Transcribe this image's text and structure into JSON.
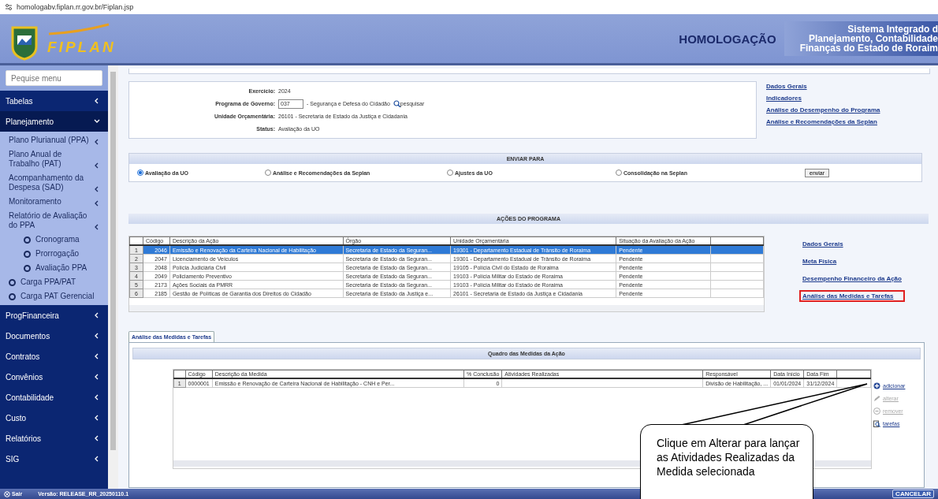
{
  "browser": {
    "url": "homologabv.fiplan.rr.gov.br/Fiplan.jsp"
  },
  "header": {
    "logo_text": "FIPLAN",
    "environment": "HOMOLOGAÇÃO",
    "system_name": [
      "Sistema Integrado d",
      "Planejamento, Contabilidade",
      "Finanças do Estado de Roraim"
    ]
  },
  "sidebar": {
    "search": {
      "placeholder": "Pequise menu"
    },
    "items": [
      {
        "label": "Tabelas",
        "kind": "menu",
        "expanded": false
      },
      {
        "label": "Planejamento",
        "kind": "menu",
        "expanded": true,
        "children": [
          {
            "label": "Plano Plurianual (PPA)",
            "kind": "menu"
          },
          {
            "label": "Plano Anual de Trabalho (PAT)",
            "kind": "menu"
          },
          {
            "label": "Acompanhamento da Despesa (SAD)",
            "kind": "menu"
          },
          {
            "label": "Monitoramento",
            "kind": "menu"
          },
          {
            "label": "Relatório de Avaliação do PPA",
            "kind": "menu",
            "children": [
              {
                "label": "Cronograma",
                "kind": "link"
              },
              {
                "label": "Prorrogação",
                "kind": "link"
              },
              {
                "label": "Avaliação PPA",
                "kind": "link"
              }
            ]
          },
          {
            "label": "Carga PPA/PAT",
            "kind": "link"
          },
          {
            "label": "Carga PAT Gerencial",
            "kind": "link"
          }
        ]
      },
      {
        "label": "ProgFinanceira",
        "kind": "menu",
        "expanded": false
      },
      {
        "label": "Documentos",
        "kind": "menu",
        "expanded": false
      },
      {
        "label": "Contratos",
        "kind": "menu",
        "expanded": false
      },
      {
        "label": "Convênios",
        "kind": "menu",
        "expanded": false
      },
      {
        "label": "Contabilidade",
        "kind": "menu",
        "expanded": false
      },
      {
        "label": "Custo",
        "kind": "menu",
        "expanded": false
      },
      {
        "label": "Relatórios",
        "kind": "menu",
        "expanded": false
      },
      {
        "label": "SIG",
        "kind": "menu",
        "expanded": false
      }
    ]
  },
  "program": {
    "fields": [
      {
        "label": "Exercício:",
        "kind": "text",
        "value": "2024"
      },
      {
        "label": "Programa de Governo:",
        "kind": "input",
        "value": "037",
        "description": "- Segurança e Defesa do Cidadão",
        "action": "pesquisar"
      },
      {
        "label": "Unidade Orçamentária:",
        "kind": "text",
        "value": "26101 - Secretaria de Estado da Justiça e Cidadania"
      },
      {
        "label": "Status:",
        "kind": "text",
        "value": "Avaliação da UO"
      }
    ],
    "links": [
      "Dados Gerais",
      "Indicadores",
      "Análise do Desempenho do Programa",
      "Análise e Recomendações da Seplan"
    ]
  },
  "send_to": {
    "title": "ENVIAR PARA",
    "options": [
      {
        "label": "Avaliação da UO",
        "selected": true
      },
      {
        "label": "Análise e Recomendações da Seplan",
        "selected": false
      },
      {
        "label": "Ajustes da UO",
        "selected": false
      },
      {
        "label": "Consolidação na Seplan",
        "selected": false
      }
    ],
    "button": "enviar"
  },
  "actions": {
    "title": "AÇÕES DO PROGRAMA",
    "columns": [
      "Código",
      "Descrição da Ação",
      "Órgão",
      "Unidade Orçamentária",
      "Situação da Avaliação da Ação"
    ],
    "rows": [
      {
        "index": "1",
        "selected": true,
        "cells": [
          "2046",
          "Emissão e Renovação da Carteira Nacional de Habilitação",
          "Secretaria de Estado da Seguran...",
          "19301 - Departamento Estadual de Trânsito de Roraima",
          "Pendente"
        ]
      },
      {
        "index": "2",
        "selected": false,
        "cells": [
          "2047",
          "Licenciamento de Veículos",
          "Secretaria de Estado da Seguran...",
          "19301 - Departamento Estadual de Trânsito de Roraima",
          "Pendente"
        ]
      },
      {
        "index": "3",
        "selected": false,
        "cells": [
          "2048",
          "Polícia Judiciária Civil",
          "Secretaria de Estado da Seguran...",
          "19105 - Polícia Civil do Estado de Roraima",
          "Pendente"
        ]
      },
      {
        "index": "4",
        "selected": false,
        "cells": [
          "2049",
          "Policiamento Preventivo",
          "Secretaria de Estado da Seguran...",
          "19103 - Polícia Militar do Estado de Roraima",
          "Pendente"
        ]
      },
      {
        "index": "5",
        "selected": false,
        "cells": [
          "2173",
          "Ações Sociais da PMRR",
          "Secretaria de Estado da Seguran...",
          "19103 - Polícia Militar do Estado de Roraima",
          "Pendente"
        ]
      },
      {
        "index": "6",
        "selected": false,
        "cells": [
          "2185",
          "Gestão de Políticas de Garantia dos Direitos do Cidadão",
          "Secretaria de Estado da Justiça e...",
          "26101 - Secretaria de Estado da Justiça e Cidadania",
          "Pendente"
        ]
      }
    ],
    "links": [
      {
        "label": "Dados Gerais",
        "highlighted": false
      },
      {
        "label": "Meta Física",
        "highlighted": false
      },
      {
        "label": "Desempenho Financeiro da Ação",
        "highlighted": false
      },
      {
        "label": "Análise das Medidas e Tarefas",
        "highlighted": true
      }
    ]
  },
  "measures": {
    "tabs": [
      {
        "label": "Análise das Medidas e Tarefas",
        "selected": true
      }
    ],
    "title": "Quadro das Medidas da Ação",
    "columns": [
      "Código",
      "Descrição da Medida",
      "% Conclusão",
      "Atividades Realizadas",
      "Responsável",
      "Data Início",
      "Data Fim"
    ],
    "rows": [
      {
        "index": "1",
        "selected": false,
        "cells": [
          "0000001",
          "Emissão e Renovação de Carteira Nacional de Habilitação - CNH e Per...",
          "0",
          null,
          "Divisão de Habilitação, ...",
          "01/01/2024",
          "31/12/2024"
        ]
      }
    ],
    "buttons": [
      {
        "label": "adicionar",
        "kind": "add",
        "disabled": false
      },
      {
        "label": "alterar",
        "kind": "edit",
        "disabled": true
      },
      {
        "label": "remover",
        "kind": "remove",
        "disabled": true
      },
      {
        "label": "tarefas",
        "kind": "tasks",
        "disabled": false
      }
    ]
  },
  "callout": {
    "text": "Clique em Alterar para lançar as Atividades Realizadas da Medida selecionada"
  },
  "footer": {
    "exit": "Sair",
    "version": "Versão: RELEASE_RR_20250110.1",
    "cancel": "CANCELAR"
  }
}
